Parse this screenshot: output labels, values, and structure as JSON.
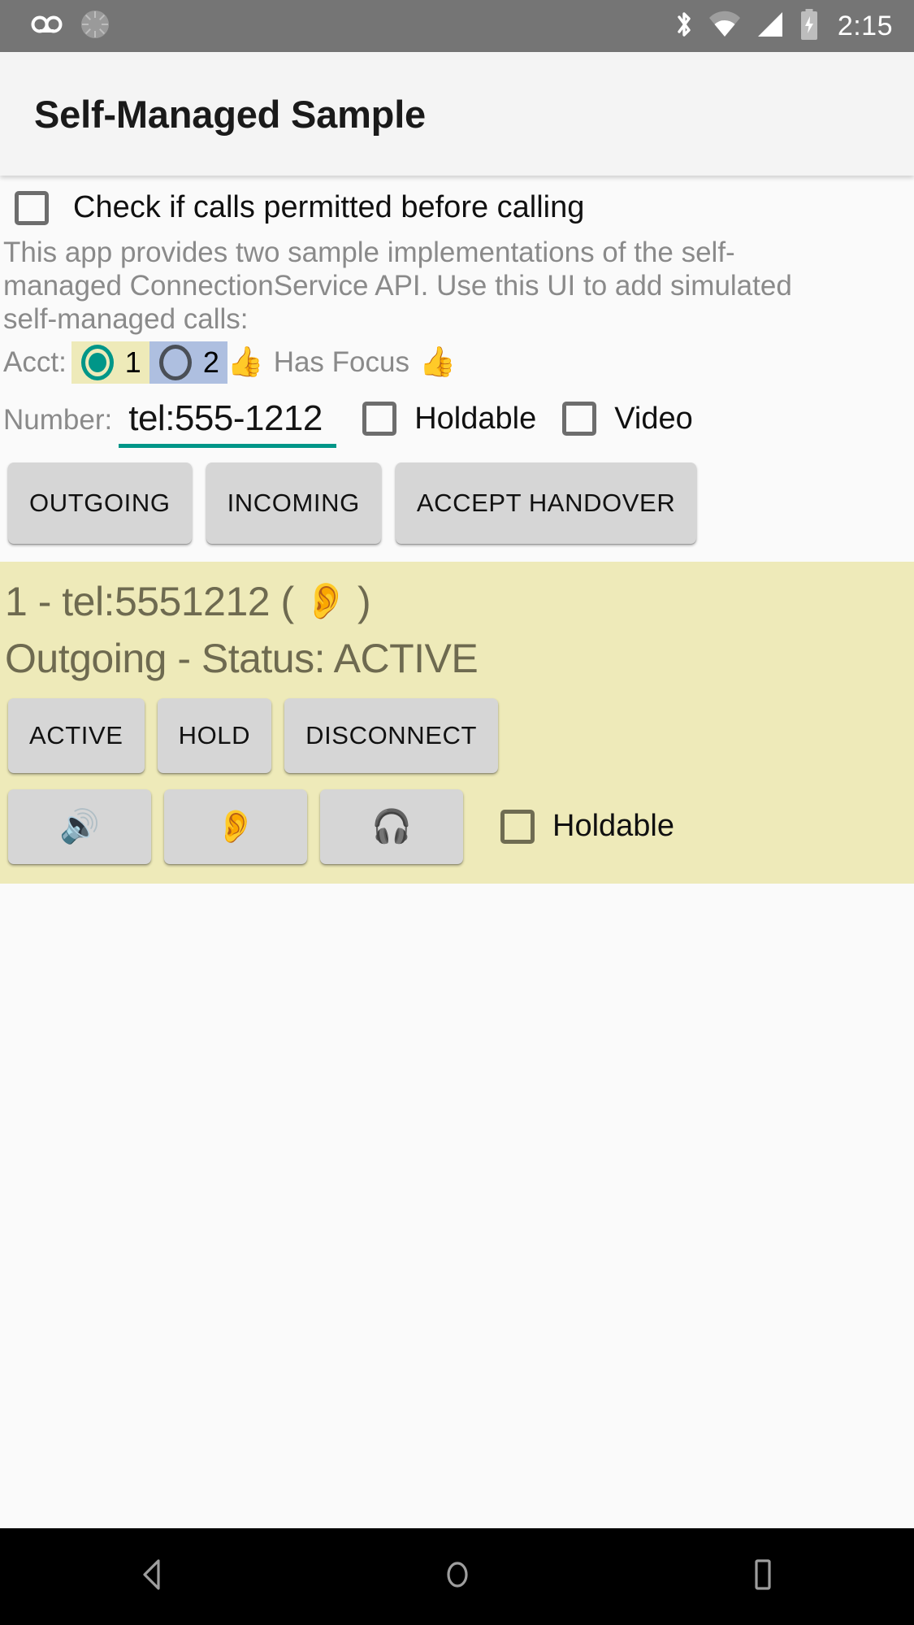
{
  "status_bar": {
    "icons": [
      "voicemail-icon",
      "sync-icon",
      "bluetooth-icon",
      "wifi-icon",
      "cellular-signal-icon",
      "battery-charging-icon"
    ],
    "time": "2:15",
    "background": "#757575",
    "foreground": "#ffffff"
  },
  "action_bar": {
    "title": "Self-Managed Sample",
    "background": "#f4f4f4"
  },
  "permission": {
    "label": "Check if calls permitted before calling",
    "checked": false
  },
  "description": "This app provides two sample implementations of the self-managed ConnectionService API.  Use this UI to add simulated self-managed calls:",
  "account": {
    "label": "Acct:",
    "options": [
      {
        "value": "1",
        "selected": true,
        "chip_color": "#eeeab9",
        "accent": "#009688"
      },
      {
        "value": "2",
        "selected": false,
        "chip_color": "#aebfe0",
        "accent": "#4a4f57"
      }
    ],
    "focus_left_icon": "thumbs-up-icon",
    "focus_label": "Has Focus",
    "focus_right_icon": "thumbs-up-icon"
  },
  "number": {
    "label": "Number:",
    "value": "tel:555-1212",
    "placeholder": "tel:555-1212",
    "underline_color": "#009688",
    "holdable": {
      "label": "Holdable",
      "checked": false
    },
    "video": {
      "label": "Video",
      "checked": false
    }
  },
  "actions": {
    "outgoing": "OUTGOING",
    "incoming": "INCOMING",
    "accept_handover": "ACCEPT HANDOVER"
  },
  "call_card": {
    "background": "#eeeab9",
    "text_color": "#6e6a50",
    "title_prefix": "1 - tel:5551212 (",
    "title_audio_icon": "ear-icon",
    "title_suffix": ")",
    "status_line": "Outgoing - Status: ACTIVE",
    "state_buttons": [
      "ACTIVE",
      "HOLD",
      "DISCONNECT"
    ],
    "audio_buttons": [
      {
        "name": "speaker-icon",
        "glyph": "🔊"
      },
      {
        "name": "earpiece-icon",
        "glyph": "👂"
      },
      {
        "name": "headset-icon",
        "glyph": "🎧"
      }
    ],
    "holdable": {
      "label": "Holdable",
      "checked": false
    }
  },
  "nav_bar": {
    "back": "back-icon",
    "home": "home-icon",
    "recents": "recents-icon",
    "background": "#000000"
  }
}
